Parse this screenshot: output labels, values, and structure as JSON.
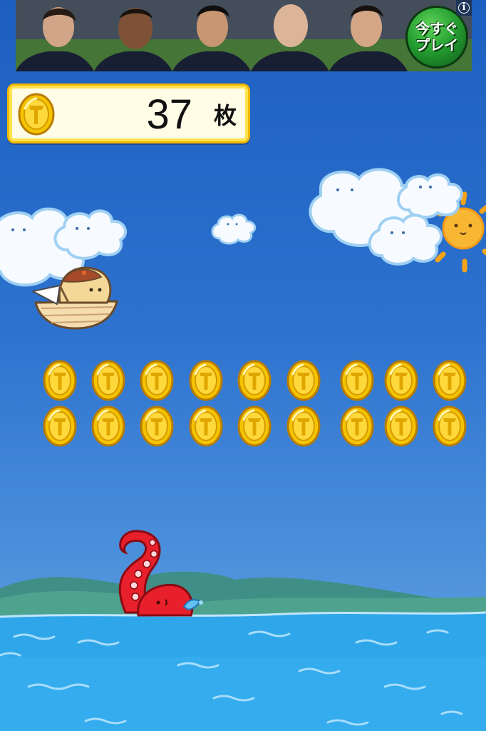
{
  "ad": {
    "play_label": "今すぐ\nプレイ",
    "info_label": "i"
  },
  "hud": {
    "coin_count": "37",
    "coin_unit": "枚"
  },
  "coin_grid": {
    "rows": 2,
    "columns": 9
  },
  "colors": {
    "sky_top": "#1d5fc0",
    "sea": "#2fa6ea",
    "coin_gold": "#f5c400",
    "panel_border": "#f2b800",
    "octopus": "#e8202b"
  },
  "icons": [
    "coin-icon",
    "cloud-icon",
    "sun-icon",
    "boat-icon",
    "octopus-tentacle-icon",
    "info-icon"
  ]
}
